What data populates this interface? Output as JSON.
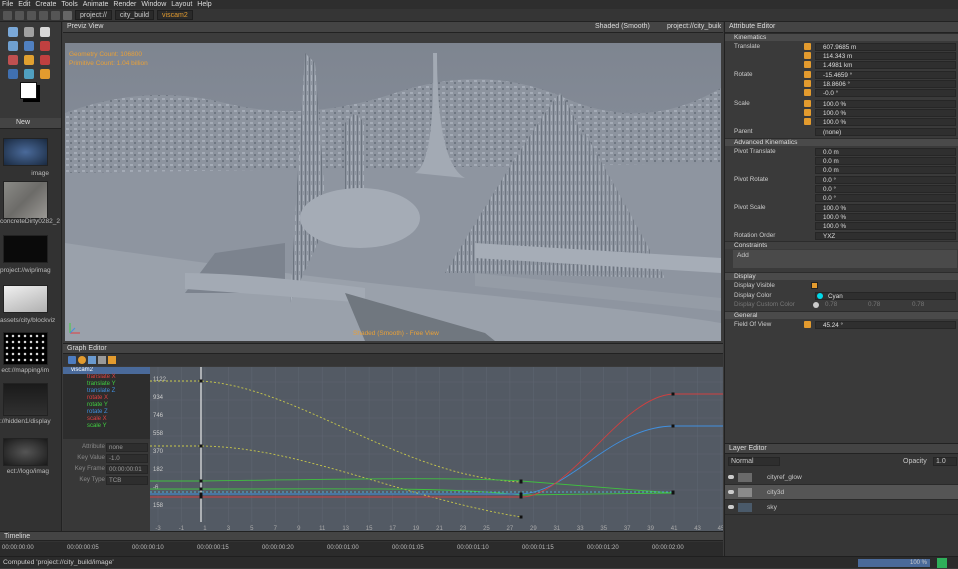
{
  "menu": [
    "File",
    "Edit",
    "Create",
    "Tools",
    "Animate",
    "Render",
    "Window",
    "Layout",
    "Help"
  ],
  "breadcrumbs": [
    "project://",
    "city_build",
    "viscam2"
  ],
  "viewport": {
    "title": "Previz View",
    "shading_menu": "Shaded (Smooth)",
    "path_menu": "project://city_build",
    "overlay_line1": "Geometry Count: 106800",
    "overlay_line2": "Primitive Count: 1.04 billion",
    "footer": "Shaded (Smooth) - Free View"
  },
  "assets": {
    "new_label": "New",
    "items": [
      {
        "label": "image"
      },
      {
        "label": "concreteDirty0282_2"
      },
      {
        "label": "project://wip/imag"
      },
      {
        "label": "assets/city/blockviz"
      },
      {
        "label": "ect://mapping/im"
      },
      {
        "label": "://hidden1/display"
      },
      {
        "label": "ect://logo/imag"
      }
    ]
  },
  "graph": {
    "title": "Graph Editor",
    "camera": "viscam2",
    "channels": [
      {
        "name": "translate X",
        "color": "#e04040"
      },
      {
        "name": "translate Y",
        "color": "#40d040"
      },
      {
        "name": "translate Z",
        "color": "#4090e0"
      },
      {
        "name": "rotate X",
        "color": "#e04040"
      },
      {
        "name": "rotate Y",
        "color": "#40d040"
      },
      {
        "name": "rotate Z",
        "color": "#4090e0"
      },
      {
        "name": "scale X",
        "color": "#e04040"
      },
      {
        "name": "scale Y",
        "color": "#40d040"
      }
    ],
    "attribute_label": "Attribute",
    "attribute_value": "none",
    "keyvalue_label": "Key Value",
    "keyvalue_value": "-1.0",
    "keyframe_label": "Key Frame",
    "keyframe_value": "00:00:00:01",
    "keytype_label": "Key Type",
    "keytype_value": "TCB",
    "y_ticks": [
      "1122",
      "934",
      "746",
      "558",
      "370",
      "182",
      "-6",
      "158"
    ],
    "x_ticks": [
      "-3",
      "-1",
      "1",
      "3",
      "5",
      "7",
      "9",
      "11",
      "13",
      "15",
      "17",
      "19",
      "21",
      "23",
      "25",
      "27",
      "29",
      "31",
      "33",
      "35",
      "37",
      "39",
      "41",
      "43",
      "45"
    ]
  },
  "timeline": {
    "title": "Timeline",
    "current": "00:00:00:00",
    "ticks": [
      "00:00:00:00",
      "00:00:00:05",
      "00:00:00:10",
      "00:00:00:15",
      "00:00:00:20",
      "00:00:01:00",
      "00:00:01:05",
      "00:00:01:10",
      "00:00:01:15",
      "00:00:01:20",
      "00:00:02:00"
    ],
    "end": "00:00:02:00"
  },
  "status": {
    "text": "Computed 'project://city_build/image'",
    "progress": "100 %"
  },
  "attribute_editor": {
    "title": "Attribute Editor",
    "kinematics": "Kinematics",
    "translate": "Translate",
    "translate_vals": [
      "607.9685 m",
      "114.343 m",
      "1.4981 km"
    ],
    "rotate": "Rotate",
    "rotate_vals": [
      "-15.4659 °",
      "18.8606 °",
      "-0.0 °"
    ],
    "scale": "Scale",
    "scale_vals": [
      "100.0 %",
      "100.0 %",
      "100.0 %"
    ],
    "parent": "Parent",
    "parent_val": "(none)",
    "adv": "Advanced Kinematics",
    "pivot_translate": "Pivot Translate",
    "pt_vals": [
      "0.0 m",
      "0.0 m",
      "0.0 m"
    ],
    "pivot_rotate": "Pivot Rotate",
    "pr_vals": [
      "0.0 °",
      "0.0 °",
      "0.0 °"
    ],
    "pivot_scale": "Pivot Scale",
    "ps_vals": [
      "100.0 %",
      "100.0 %",
      "100.0 %"
    ],
    "rotation_order": "Rotation Order",
    "rotation_order_val": "YXZ",
    "constraints": "Constraints",
    "add": "Add",
    "display": "Display",
    "display_visible": "Display Visible",
    "display_color": "Display Color",
    "display_color_val": "Cyan",
    "custom_color": "Display Custom Color",
    "custom_vals": [
      "0.78",
      "0.78",
      "0.78"
    ],
    "general": "General",
    "fov": "Field Of View",
    "fov_val": "45.24 °"
  },
  "layer_editor": {
    "title": "Layer Editor",
    "blend": "Normal",
    "opacity_label": "Opacity",
    "opacity": "1.0",
    "layers": [
      {
        "name": "cityref_glow"
      },
      {
        "name": "city3d"
      },
      {
        "name": "sky"
      }
    ]
  }
}
